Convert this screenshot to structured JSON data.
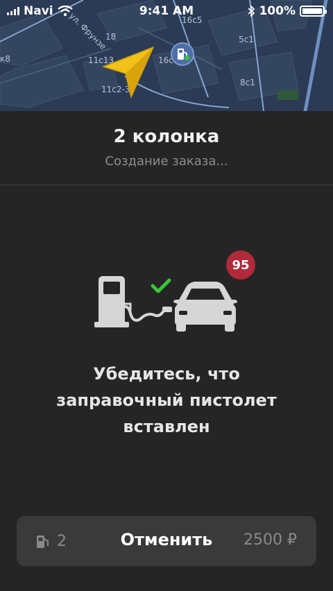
{
  "status_bar": {
    "carrier": "Navi",
    "time": "9:41 AM",
    "battery": "100%",
    "battery_level": 1.0
  },
  "map": {
    "labels": [
      "ул. Фрунзе",
      "18",
      "16с5",
      "5с1",
      "к8",
      "11с13",
      "16с1",
      "11с2-3",
      "8с1"
    ],
    "icons": [
      "navigation-arrow-icon",
      "fuel-station-pin-icon",
      "wifi-icon",
      "bluetooth-icon"
    ]
  },
  "order": {
    "title": "2 колонка",
    "status": "Создание заказа..."
  },
  "illustration": {
    "octane_badge": "95",
    "check_color": "#3ac43a",
    "badge_color": "#b02a3a"
  },
  "instruction": "Убедитесь, что заправочный пистолет вставлен",
  "footer": {
    "pump_number": "2",
    "cancel_label": "Отменить",
    "price": "2500 ₽"
  }
}
